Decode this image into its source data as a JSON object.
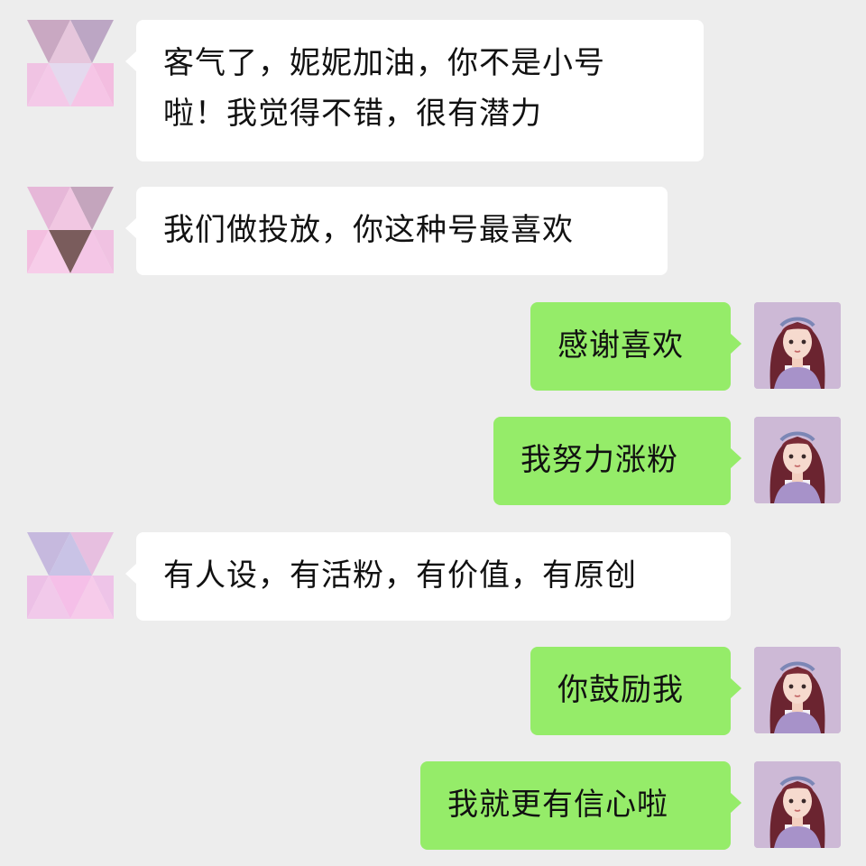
{
  "colors": {
    "background": "#ededed",
    "incoming_bubble": "#ffffff",
    "outgoing_bubble": "#95ec69",
    "text": "#111111"
  },
  "messages": [
    {
      "sender": "contact",
      "lines": [
        "客气了，妮妮加油，你不是小号",
        "啦！我觉得不错，很有潜力"
      ]
    },
    {
      "sender": "contact",
      "lines": [
        "我们做投放，你这种号最喜欢"
      ]
    },
    {
      "sender": "me",
      "lines": [
        "感谢喜欢"
      ]
    },
    {
      "sender": "me",
      "lines": [
        "我努力涨粉"
      ]
    },
    {
      "sender": "contact",
      "lines": [
        "有人设，有活粉，有价值，有原创"
      ]
    },
    {
      "sender": "me",
      "lines": [
        "你鼓励我"
      ]
    },
    {
      "sender": "me",
      "lines": [
        "我就更有信心啦"
      ]
    }
  ],
  "avatars": {
    "contact": "geometric-triangle-avatar-icon",
    "me": "cartoon-girl-avatar-icon"
  }
}
